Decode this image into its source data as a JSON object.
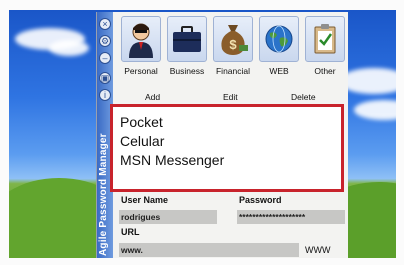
{
  "app": {
    "title": "Agile Password Manager"
  },
  "toolbar": {
    "categories": [
      {
        "label": "Personal",
        "icon": "person-icon"
      },
      {
        "label": "Business",
        "icon": "briefcase-icon"
      },
      {
        "label": "Financial",
        "icon": "money-bag-icon"
      },
      {
        "label": "WEB",
        "icon": "globe-icon"
      },
      {
        "label": "Other",
        "icon": "clipboard-icon"
      }
    ]
  },
  "actions": {
    "add": "Add",
    "edit": "Edit",
    "delete": "Delete"
  },
  "list": {
    "items": [
      "Pocket",
      "Celular",
      "MSN Messenger"
    ]
  },
  "form": {
    "username_label": "User Name",
    "username_value": "rodrigues",
    "password_label": "Password",
    "password_value": "********************",
    "url_label": "URL",
    "url_value": "www.",
    "url_link": "WWW"
  },
  "colors": {
    "highlight": "#c8232c",
    "sidebar": "#3a6bc5",
    "panel": "#f3f3f1"
  }
}
